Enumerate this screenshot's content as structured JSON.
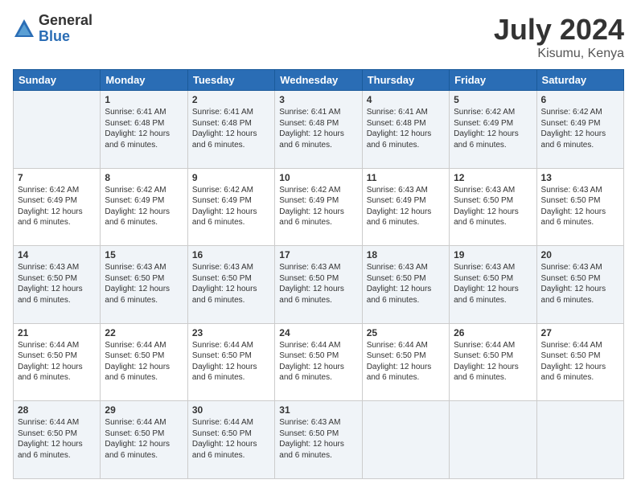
{
  "logo": {
    "general": "General",
    "blue": "Blue"
  },
  "title": {
    "month_year": "July 2024",
    "location": "Kisumu, Kenya"
  },
  "days": [
    "Sunday",
    "Monday",
    "Tuesday",
    "Wednesday",
    "Thursday",
    "Friday",
    "Saturday"
  ],
  "weeks": [
    [
      {
        "day": "",
        "content": ""
      },
      {
        "day": "1",
        "content": "Sunrise: 6:41 AM\nSunset: 6:48 PM\nDaylight: 12 hours\nand 6 minutes."
      },
      {
        "day": "2",
        "content": "Sunrise: 6:41 AM\nSunset: 6:48 PM\nDaylight: 12 hours\nand 6 minutes."
      },
      {
        "day": "3",
        "content": "Sunrise: 6:41 AM\nSunset: 6:48 PM\nDaylight: 12 hours\nand 6 minutes."
      },
      {
        "day": "4",
        "content": "Sunrise: 6:41 AM\nSunset: 6:48 PM\nDaylight: 12 hours\nand 6 minutes."
      },
      {
        "day": "5",
        "content": "Sunrise: 6:42 AM\nSunset: 6:49 PM\nDaylight: 12 hours\nand 6 minutes."
      },
      {
        "day": "6",
        "content": "Sunrise: 6:42 AM\nSunset: 6:49 PM\nDaylight: 12 hours\nand 6 minutes."
      }
    ],
    [
      {
        "day": "7",
        "content": "Sunrise: 6:42 AM\nSunset: 6:49 PM\nDaylight: 12 hours\nand 6 minutes."
      },
      {
        "day": "8",
        "content": "Sunrise: 6:42 AM\nSunset: 6:49 PM\nDaylight: 12 hours\nand 6 minutes."
      },
      {
        "day": "9",
        "content": "Sunrise: 6:42 AM\nSunset: 6:49 PM\nDaylight: 12 hours\nand 6 minutes."
      },
      {
        "day": "10",
        "content": "Sunrise: 6:42 AM\nSunset: 6:49 PM\nDaylight: 12 hours\nand 6 minutes."
      },
      {
        "day": "11",
        "content": "Sunrise: 6:43 AM\nSunset: 6:49 PM\nDaylight: 12 hours\nand 6 minutes."
      },
      {
        "day": "12",
        "content": "Sunrise: 6:43 AM\nSunset: 6:50 PM\nDaylight: 12 hours\nand 6 minutes."
      },
      {
        "day": "13",
        "content": "Sunrise: 6:43 AM\nSunset: 6:50 PM\nDaylight: 12 hours\nand 6 minutes."
      }
    ],
    [
      {
        "day": "14",
        "content": "Sunrise: 6:43 AM\nSunset: 6:50 PM\nDaylight: 12 hours\nand 6 minutes."
      },
      {
        "day": "15",
        "content": "Sunrise: 6:43 AM\nSunset: 6:50 PM\nDaylight: 12 hours\nand 6 minutes."
      },
      {
        "day": "16",
        "content": "Sunrise: 6:43 AM\nSunset: 6:50 PM\nDaylight: 12 hours\nand 6 minutes."
      },
      {
        "day": "17",
        "content": "Sunrise: 6:43 AM\nSunset: 6:50 PM\nDaylight: 12 hours\nand 6 minutes."
      },
      {
        "day": "18",
        "content": "Sunrise: 6:43 AM\nSunset: 6:50 PM\nDaylight: 12 hours\nand 6 minutes."
      },
      {
        "day": "19",
        "content": "Sunrise: 6:43 AM\nSunset: 6:50 PM\nDaylight: 12 hours\nand 6 minutes."
      },
      {
        "day": "20",
        "content": "Sunrise: 6:43 AM\nSunset: 6:50 PM\nDaylight: 12 hours\nand 6 minutes."
      }
    ],
    [
      {
        "day": "21",
        "content": "Sunrise: 6:44 AM\nSunset: 6:50 PM\nDaylight: 12 hours\nand 6 minutes."
      },
      {
        "day": "22",
        "content": "Sunrise: 6:44 AM\nSunset: 6:50 PM\nDaylight: 12 hours\nand 6 minutes."
      },
      {
        "day": "23",
        "content": "Sunrise: 6:44 AM\nSunset: 6:50 PM\nDaylight: 12 hours\nand 6 minutes."
      },
      {
        "day": "24",
        "content": "Sunrise: 6:44 AM\nSunset: 6:50 PM\nDaylight: 12 hours\nand 6 minutes."
      },
      {
        "day": "25",
        "content": "Sunrise: 6:44 AM\nSunset: 6:50 PM\nDaylight: 12 hours\nand 6 minutes."
      },
      {
        "day": "26",
        "content": "Sunrise: 6:44 AM\nSunset: 6:50 PM\nDaylight: 12 hours\nand 6 minutes."
      },
      {
        "day": "27",
        "content": "Sunrise: 6:44 AM\nSunset: 6:50 PM\nDaylight: 12 hours\nand 6 minutes."
      }
    ],
    [
      {
        "day": "28",
        "content": "Sunrise: 6:44 AM\nSunset: 6:50 PM\nDaylight: 12 hours\nand 6 minutes."
      },
      {
        "day": "29",
        "content": "Sunrise: 6:44 AM\nSunset: 6:50 PM\nDaylight: 12 hours\nand 6 minutes."
      },
      {
        "day": "30",
        "content": "Sunrise: 6:44 AM\nSunset: 6:50 PM\nDaylight: 12 hours\nand 6 minutes."
      },
      {
        "day": "31",
        "content": "Sunrise: 6:43 AM\nSunset: 6:50 PM\nDaylight: 12 hours\nand 6 minutes."
      },
      {
        "day": "",
        "content": ""
      },
      {
        "day": "",
        "content": ""
      },
      {
        "day": "",
        "content": ""
      }
    ]
  ]
}
